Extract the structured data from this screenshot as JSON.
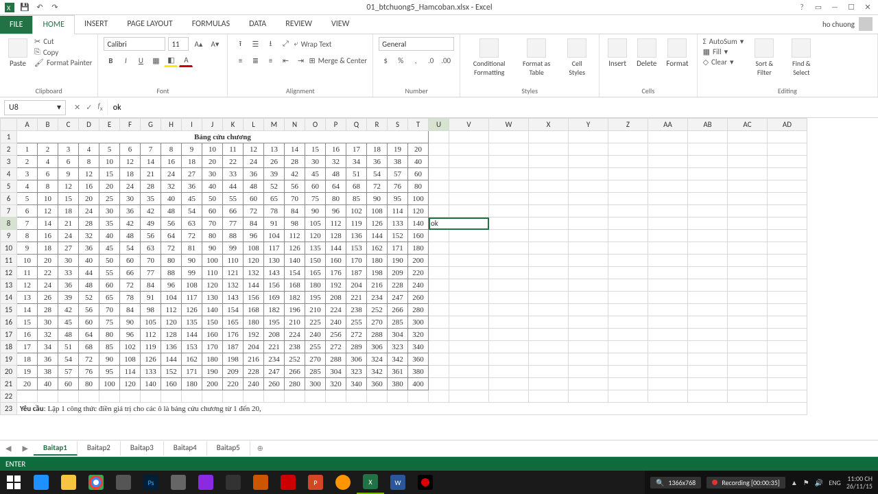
{
  "app": {
    "title": "01_btchuong5_Hamcoban.xlsx - Excel",
    "user": "ho chuong"
  },
  "ribbon": {
    "file": "FILE",
    "tabs": [
      "HOME",
      "INSERT",
      "PAGE LAYOUT",
      "FORMULAS",
      "DATA",
      "REVIEW",
      "VIEW"
    ],
    "active_tab": "HOME",
    "clipboard": {
      "paste": "Paste",
      "cut": "Cut",
      "copy": "Copy",
      "painter": "Format Painter",
      "label": "Clipboard"
    },
    "font": {
      "name": "Calibri",
      "size": "11",
      "label": "Font"
    },
    "alignment": {
      "wrap": "Wrap Text",
      "merge": "Merge & Center",
      "label": "Alignment"
    },
    "number": {
      "format": "General",
      "label": "Number"
    },
    "styles": {
      "cf": "Conditional Formatting",
      "fat": "Format as Table",
      "cs": "Cell Styles",
      "label": "Styles"
    },
    "cells": {
      "insert": "Insert",
      "delete": "Delete",
      "format": "Format",
      "label": "Cells"
    },
    "editing": {
      "sum": "AutoSum",
      "fill": "Fill",
      "clear": "Clear",
      "sort": "Sort & Filter",
      "find": "Find & Select",
      "label": "Editing"
    }
  },
  "formula": {
    "namebox": "U8",
    "value": "ok"
  },
  "columns": [
    "A",
    "B",
    "C",
    "D",
    "E",
    "F",
    "G",
    "H",
    "I",
    "J",
    "K",
    "L",
    "M",
    "N",
    "O",
    "P",
    "Q",
    "R",
    "S",
    "T",
    "U",
    "V",
    "W",
    "X",
    "Y",
    "Z",
    "AA",
    "AB",
    "AC",
    "AD"
  ],
  "table_title": "Bảng cửu chương",
  "note_bold": "Yêu cầu",
  "note_rest": ": Lập 1 công thức điền giá trị cho các ô là bảng cửu chương từ 1 đến 20,",
  "editing_cell": {
    "col": "U",
    "row": 8,
    "text": "ok"
  },
  "sheets": {
    "list": [
      "Baitap1",
      "Baitap2",
      "Baitap3",
      "Baitap4",
      "Baitap5"
    ],
    "active": "Baitap1"
  },
  "status": {
    "mode": "ENTER",
    "res": "1366x768",
    "rec": "Recording [00:00:35]"
  },
  "tray": {
    "lang": "ENG",
    "time": "11:00 CH",
    "date": "26/11/15"
  },
  "chart_data": {
    "type": "table",
    "title": "Bảng cửu chương",
    "rows": 20,
    "cols": 20,
    "formula": "cell(i,j) = i * j",
    "sample_first_row": [
      1,
      2,
      3,
      4,
      5,
      6,
      7,
      8,
      9,
      10,
      11,
      12,
      13,
      14,
      15,
      16,
      17,
      18,
      19,
      20
    ],
    "sample_last_row": [
      20,
      40,
      60,
      80,
      100,
      120,
      140,
      160,
      180,
      200,
      220,
      240,
      260,
      280,
      300,
      320,
      340,
      360,
      380,
      400
    ]
  }
}
